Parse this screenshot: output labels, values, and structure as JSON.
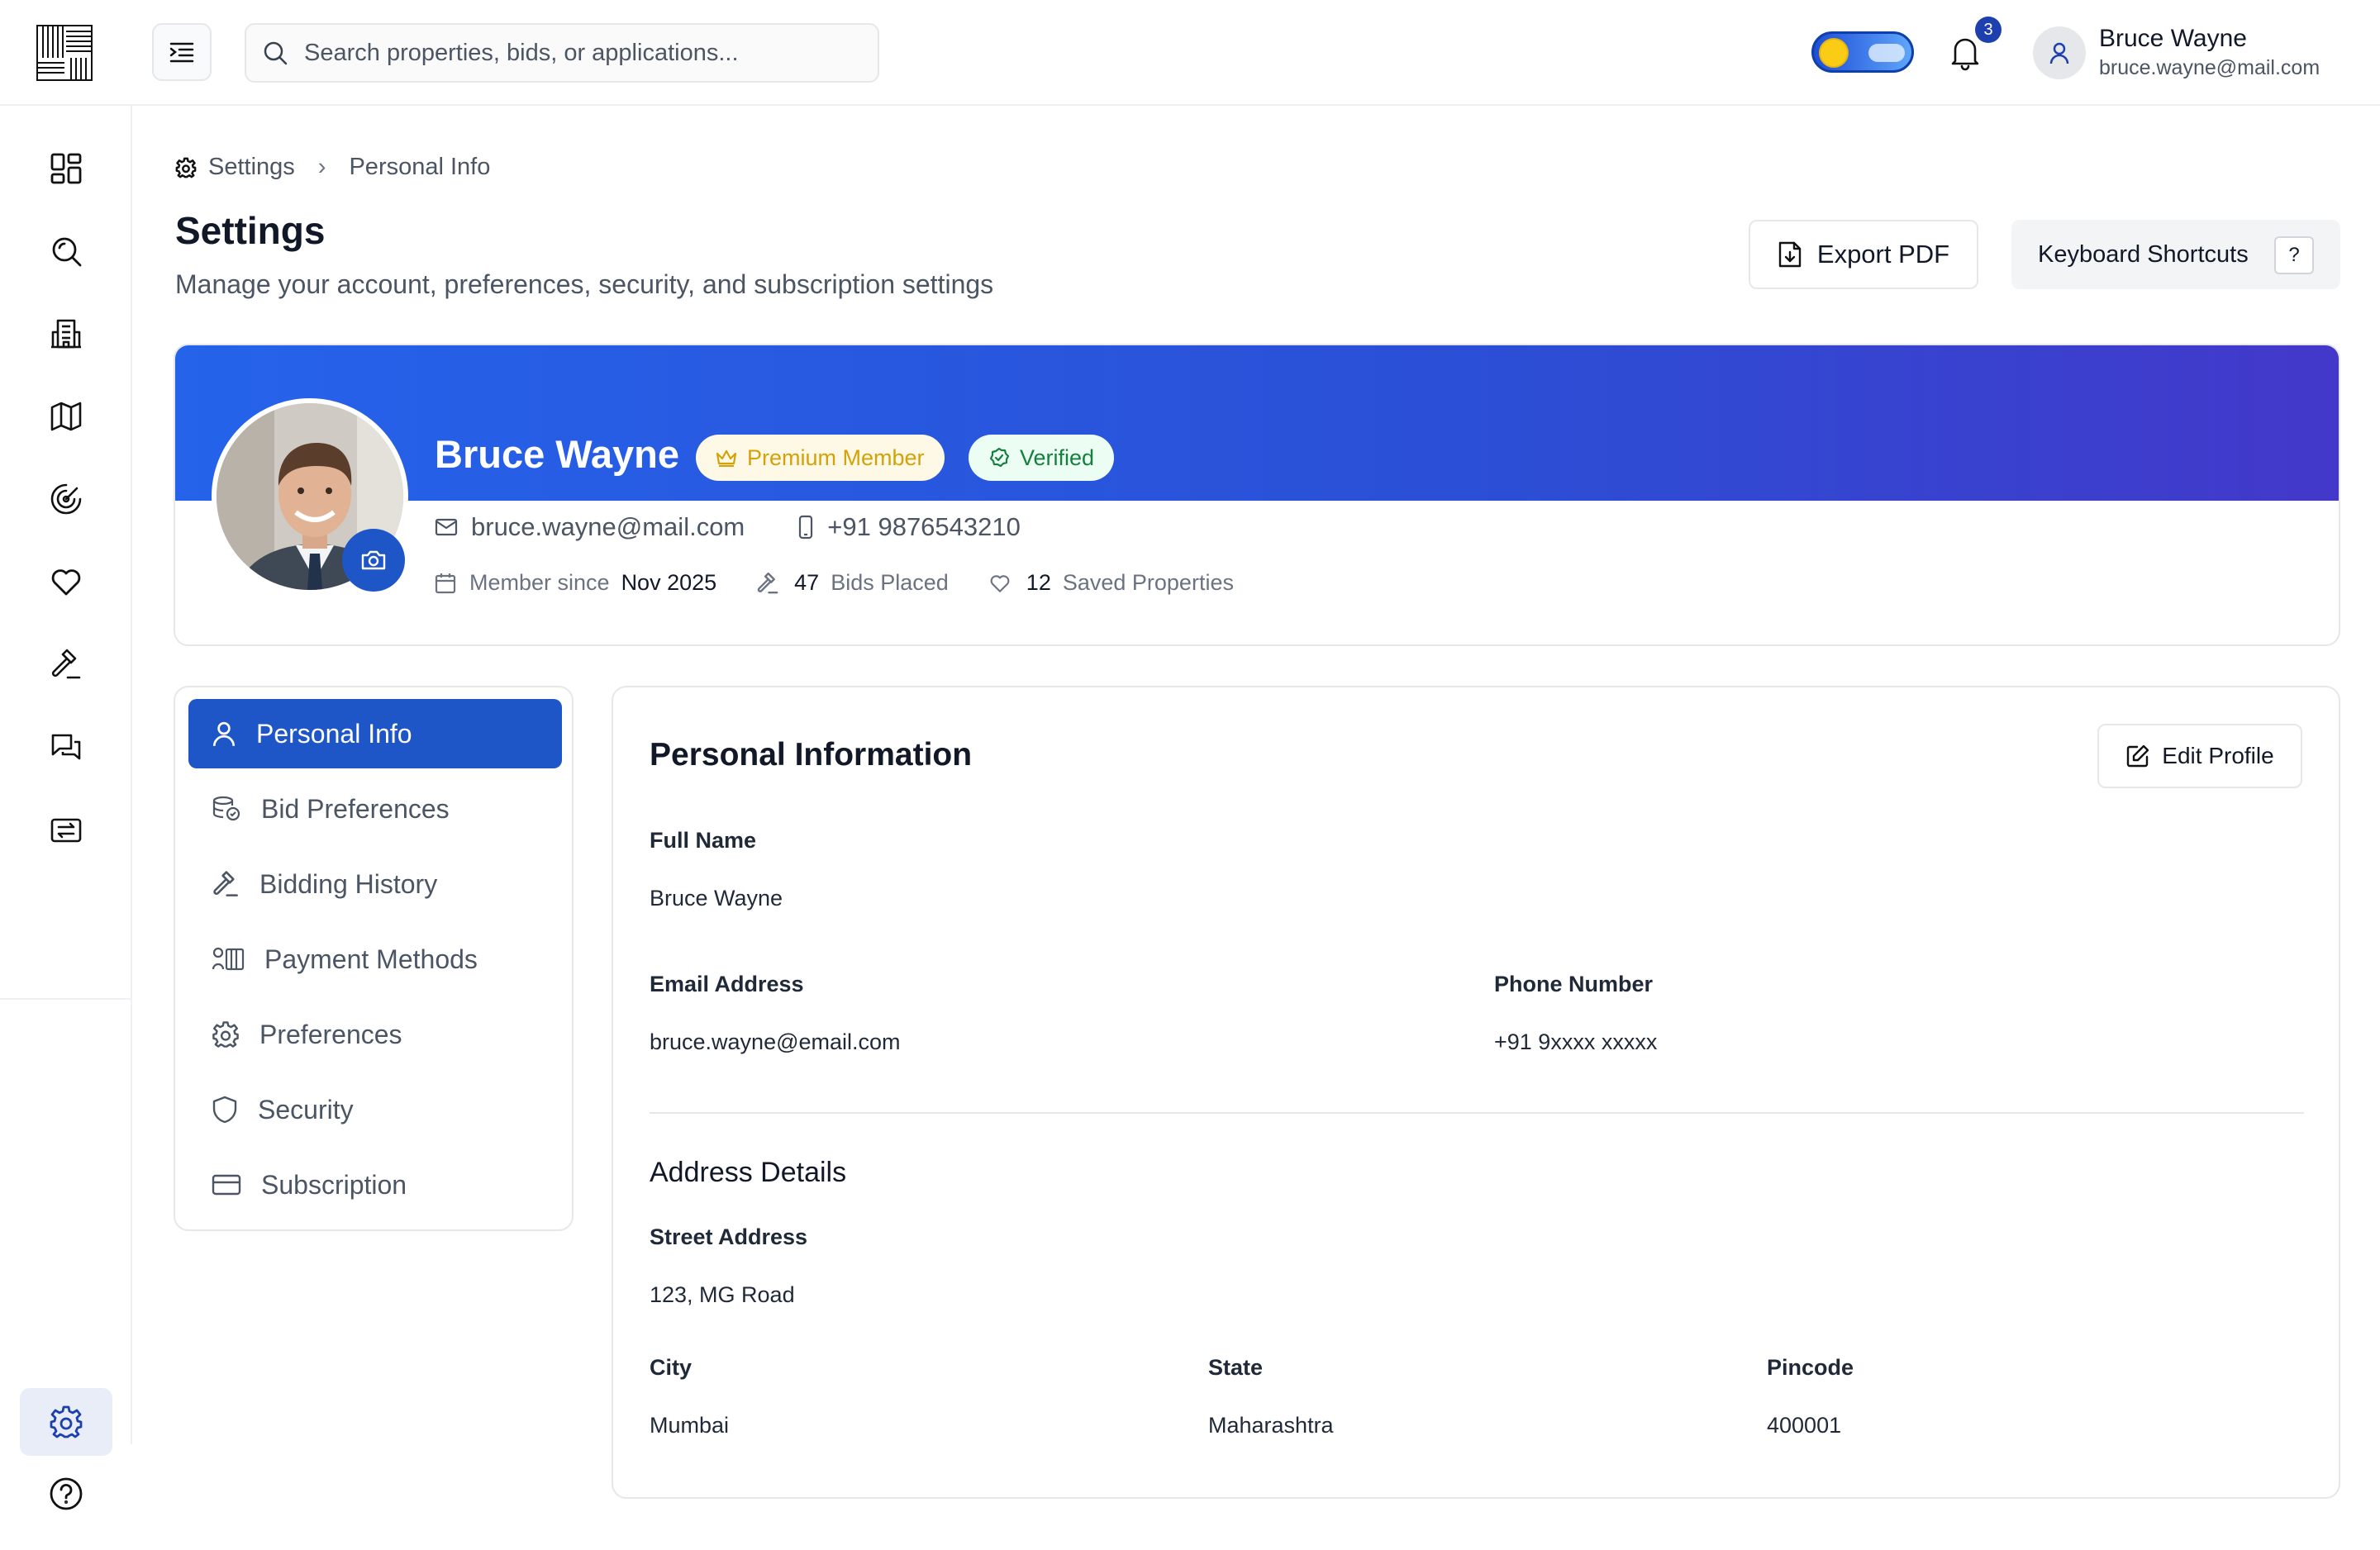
{
  "header": {
    "search_placeholder": "Search properties, bids, or applications...",
    "notification_count": "3",
    "user_name": "Bruce Wayne",
    "user_email": "bruce.wayne@mail.com"
  },
  "breadcrumb": {
    "root": "Settings",
    "current": "Personal Info"
  },
  "page": {
    "title": "Settings",
    "subtitle": "Manage your account, preferences, security, and subscription settings",
    "export_label": "Export PDF",
    "shortcuts_label": "Keyboard Shortcuts",
    "shortcuts_key": "?"
  },
  "profile": {
    "name": "Bruce Wayne",
    "premium_badge": "Premium Member",
    "verified_badge": "Verified",
    "email": "bruce.wayne@mail.com",
    "phone": "+91 9876543210",
    "member_since_label": "Member since",
    "member_since_value": "Nov 2025",
    "bids_count": "47",
    "bids_label": "Bids Placed",
    "saved_count": "12",
    "saved_label": "Saved Properties"
  },
  "settings_nav": {
    "items": [
      {
        "label": "Personal Info",
        "icon": "user-icon",
        "active": true
      },
      {
        "label": "Bid Preferences",
        "icon": "coins-icon",
        "active": false
      },
      {
        "label": "Bidding History",
        "icon": "gavel-icon",
        "active": false
      },
      {
        "label": "Payment Methods",
        "icon": "payment-icon",
        "active": false
      },
      {
        "label": "Preferences",
        "icon": "gear-icon",
        "active": false
      },
      {
        "label": "Security",
        "icon": "shield-icon",
        "active": false
      },
      {
        "label": "Subscription",
        "icon": "card-icon",
        "active": false
      }
    ]
  },
  "personal_info": {
    "title": "Personal Information",
    "edit_label": "Edit Profile",
    "full_name_label": "Full Name",
    "full_name": "Bruce Wayne",
    "email_label": "Email Address",
    "email": "bruce.wayne@email.com",
    "phone_label": "Phone Number",
    "phone": "+91 9xxxx xxxxx"
  },
  "address": {
    "title": "Address Details",
    "street_label": "Street Address",
    "street": "123, MG Road",
    "city_label": "City",
    "city": "Mumbai",
    "state_label": "State",
    "state": "Maharashtra",
    "pincode_label": "Pincode",
    "pincode": "400001"
  },
  "colors": {
    "accent": "#1e56c8",
    "banner_start": "#2563eb",
    "banner_end": "#4338ca",
    "premium": "#d4a106",
    "verified": "#15803d"
  }
}
